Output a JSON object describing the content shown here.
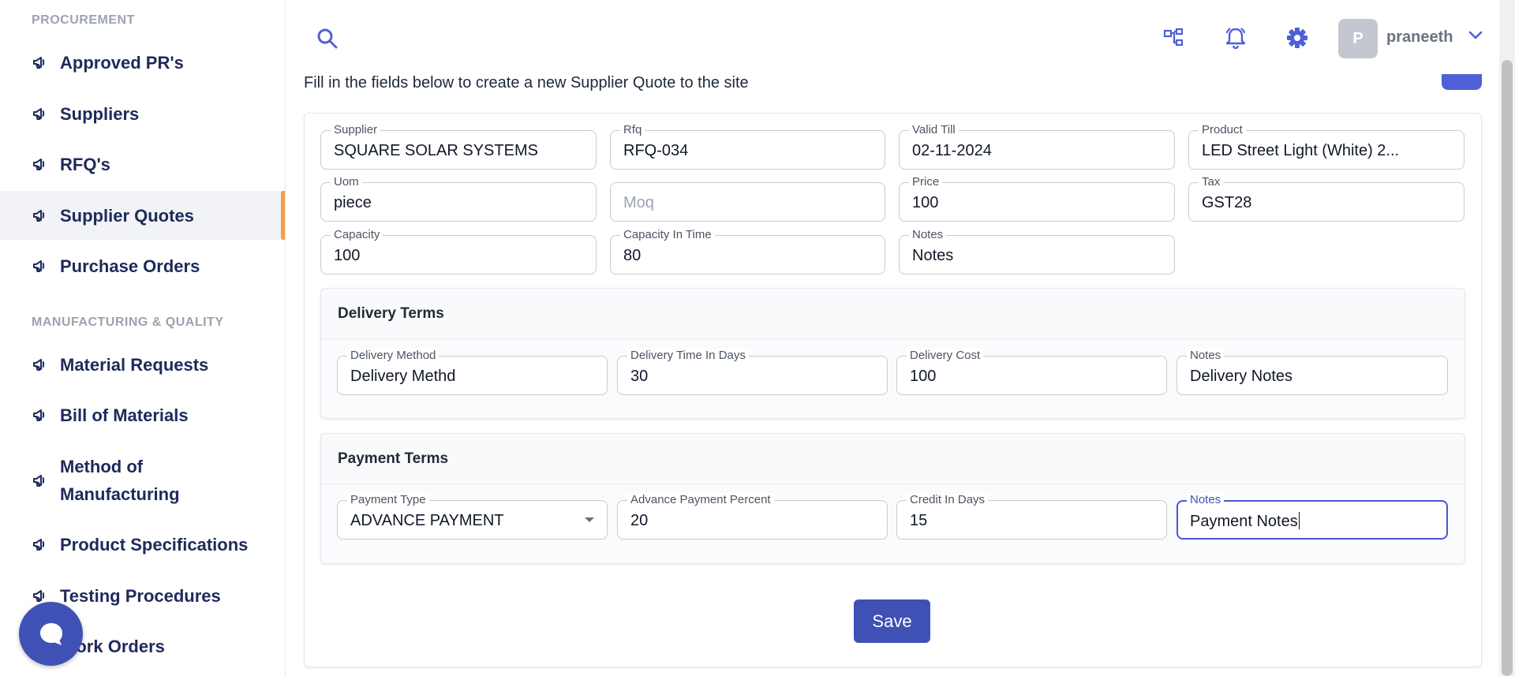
{
  "sidebar": {
    "sections": [
      {
        "title": "PROCUREMENT"
      },
      {
        "title": "MANUFACTURING & QUALITY"
      }
    ],
    "items": [
      {
        "label": "Approved PR's",
        "icon": "megaphone-icon"
      },
      {
        "label": "Suppliers",
        "icon": "megaphone-icon"
      },
      {
        "label": "RFQ's",
        "icon": "megaphone-icon"
      },
      {
        "label": "Supplier Quotes",
        "icon": "megaphone-icon",
        "active": true
      },
      {
        "label": "Purchase Orders",
        "icon": "megaphone-icon"
      },
      {
        "label": "Material Requests",
        "icon": "megaphone-icon"
      },
      {
        "label": "Bill of Materials",
        "icon": "megaphone-icon"
      },
      {
        "label": "Method of Manufacturing",
        "icon": "megaphone-icon"
      },
      {
        "label": "Product Specifications",
        "icon": "megaphone-icon"
      },
      {
        "label": "Testing Procedures",
        "icon": "megaphone-icon"
      },
      {
        "label": "Work Orders",
        "icon": "megaphone-icon"
      }
    ],
    "active_accent": "#f59e4b"
  },
  "topbar": {
    "avatar_letter": "P",
    "username": "praneeth",
    "icons": [
      "search-icon",
      "hierarchy-icon",
      "bell-icon",
      "gear-icon",
      "chevron-down-icon"
    ]
  },
  "main": {
    "intro": "Fill in the fields below to create a new Supplier Quote to the site",
    "fields": {
      "supplier": {
        "label": "Supplier",
        "value": "SQUARE SOLAR SYSTEMS"
      },
      "rfq": {
        "label": "Rfq",
        "value": "RFQ-034"
      },
      "valid_till": {
        "label": "Valid Till",
        "value": "02-11-2024"
      },
      "product": {
        "label": "Product",
        "value": "LED Street Light (White) 2..."
      },
      "uom": {
        "label": "Uom",
        "value": "piece"
      },
      "moq": {
        "placeholder": "Moq"
      },
      "price": {
        "label": "Price",
        "value": "100"
      },
      "tax": {
        "label": "Tax",
        "value": "GST28"
      },
      "capacity": {
        "label": "Capacity",
        "value": "100"
      },
      "capacity_in_time": {
        "label": "Capacity In Time",
        "value": "80"
      },
      "notes": {
        "label": "Notes",
        "value": "Notes"
      }
    },
    "delivery": {
      "title": "Delivery Terms",
      "method": {
        "label": "Delivery Method",
        "value": "Delivery Methd"
      },
      "days": {
        "label": "Delivery Time In Days",
        "value": "30"
      },
      "cost": {
        "label": "Delivery Cost",
        "value": "100"
      },
      "notes": {
        "label": "Notes",
        "value": "Delivery Notes"
      }
    },
    "payment": {
      "title": "Payment Terms",
      "type": {
        "label": "Payment Type",
        "value": "ADVANCE PAYMENT"
      },
      "advance": {
        "label": "Advance Payment Percent",
        "value": "20"
      },
      "credit": {
        "label": "Credit In Days",
        "value": "15"
      },
      "notes": {
        "label": "Notes",
        "value": "Payment Notes"
      }
    },
    "save_label": "Save",
    "accent": "#3f51b5"
  }
}
